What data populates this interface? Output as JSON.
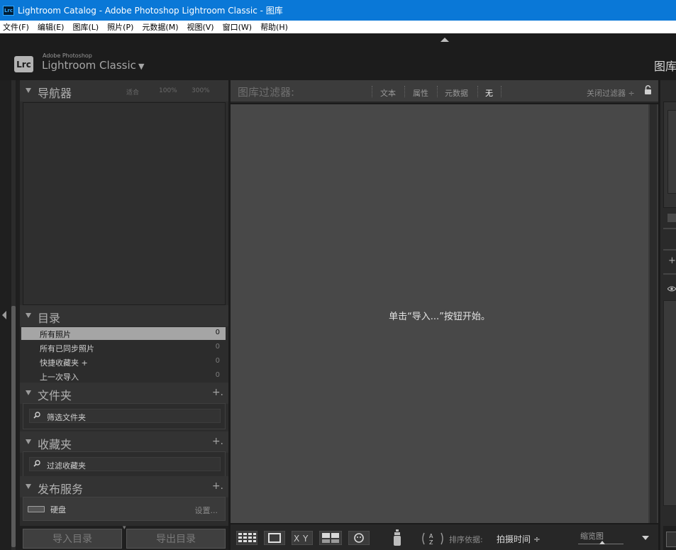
{
  "window": {
    "icon_text": "Lrc",
    "title": "Lightroom Catalog - Adobe Photoshop Lightroom Classic - 图库"
  },
  "menubar": {
    "items": [
      "文件(F)",
      "编辑(E)",
      "图库(L)",
      "照片(P)",
      "元数据(M)",
      "视图(V)",
      "窗口(W)",
      "帮助(H)"
    ]
  },
  "identity": {
    "badge": "Lrc",
    "small": "Adobe Photoshop",
    "big": "Lightroom Classic",
    "module": "图库"
  },
  "navigator": {
    "title": "导航器",
    "zoom": [
      "适合",
      "100%",
      "300%"
    ]
  },
  "catalog": {
    "title": "目录",
    "rows": [
      {
        "name": "所有照片",
        "count": "0"
      },
      {
        "name": "所有已同步照片",
        "count": "0"
      },
      {
        "name": "快捷收藏夹 +",
        "count": "0"
      },
      {
        "name": "上一次导入",
        "count": "0"
      }
    ]
  },
  "folders": {
    "title": "文件夹",
    "plus": "+.",
    "search": "筛选文件夹"
  },
  "collections": {
    "title": "收藏夹",
    "plus": "+.",
    "search": "过滤收藏夹"
  },
  "publish": {
    "title": "发布服务",
    "plus": "+.",
    "service": "硬盘",
    "settings": "设置..."
  },
  "left_buttons": {
    "import": "导入目录",
    "export": "导出目录"
  },
  "filter": {
    "label": "图库过滤器:",
    "options": [
      "文本",
      "属性",
      "元数据",
      "无"
    ],
    "active": "无",
    "close": "关闭过滤器 ÷"
  },
  "grid": {
    "message": "单击“导入...”按钮开始。"
  },
  "toolbar": {
    "sort_label": "排序依据:",
    "sort_value": "拍摄时间 ÷",
    "thumb_label": "缩览图"
  },
  "colors": {
    "titlebar": "#0a78d7",
    "selected_row": "#a5a5a5"
  }
}
